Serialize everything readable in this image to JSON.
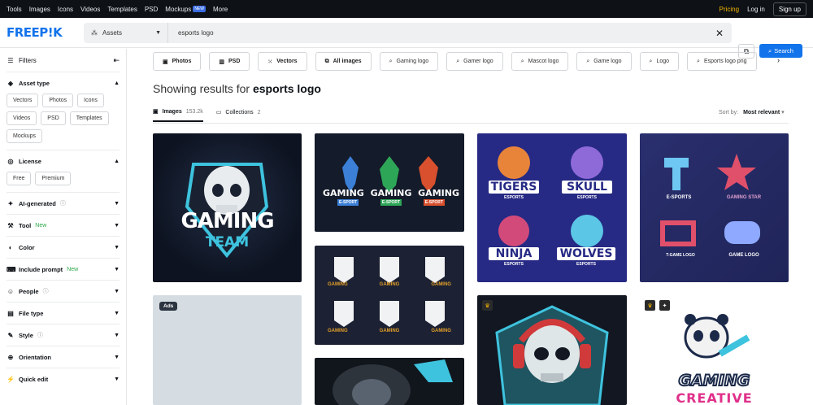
{
  "topnav": {
    "items": [
      "Tools",
      "Images",
      "Icons",
      "Videos",
      "Templates",
      "PSD",
      "Mockups",
      "More"
    ],
    "new_badge": "NEW",
    "pricing": "Pricing",
    "login": "Log in",
    "signup": "Sign up"
  },
  "header": {
    "logo": "FREEP!K",
    "asset_select": "Assets",
    "search_value": "esports logo",
    "search_button": "Search"
  },
  "sidebar": {
    "title": "Filters",
    "asset_type": {
      "label": "Asset type",
      "chips": [
        "Vectors",
        "Photos",
        "Icons",
        "Videos",
        "PSD",
        "Templates",
        "Mockups"
      ]
    },
    "license": {
      "label": "License",
      "chips": [
        "Free",
        "Premium"
      ]
    },
    "sections": [
      {
        "label": "AI-generated",
        "extra": "info"
      },
      {
        "label": "Tool",
        "extra": "New"
      },
      {
        "label": "Color",
        "extra": ""
      },
      {
        "label": "Include prompt",
        "extra": "New"
      },
      {
        "label": "People",
        "extra": "info"
      },
      {
        "label": "File type",
        "extra": ""
      },
      {
        "label": "Style",
        "extra": "info"
      },
      {
        "label": "Orientation",
        "extra": ""
      },
      {
        "label": "Quick edit",
        "extra": ""
      }
    ]
  },
  "filter_tags": [
    "Photos",
    "PSD",
    "Vectors",
    "All images"
  ],
  "suggest_tags": [
    "Gaming logo",
    "Gamer logo",
    "Mascot logo",
    "Game logo",
    "Logo",
    "Esports logo png"
  ],
  "results": {
    "prefix": "Showing results for",
    "query": "esports logo",
    "tabs": [
      {
        "label": "Images",
        "count": "153.2k"
      },
      {
        "label": "Collections",
        "count": "2"
      }
    ],
    "sort_label": "Sort by:",
    "sort_value": "Most relevant"
  },
  "cards": {
    "c1_text1": "GAMING",
    "c1_text2": "TEAM",
    "c2_labels": [
      "GAMING",
      "GAMING",
      "GAMING"
    ],
    "c2_sub": "E-SPORT",
    "c3_labels": [
      "TIGERS",
      "SKULL",
      "NINJA",
      "WOLVES"
    ],
    "c3_sub": "ESPORTS",
    "c4_labels": [
      "E-SPORTS",
      "GAMING STAR",
      "T-GAME LOGO",
      "GAME LOGO"
    ],
    "c5_labels": [
      "GAMING",
      "GAMING",
      "GAMING",
      "GAMING",
      "GAMING",
      "GAMING"
    ],
    "ads": "Ads",
    "c8_text1": "GAMING",
    "c8_text2": "CREATIVE"
  },
  "colors": {
    "accent": "#1273eb",
    "pricing": "#f5b400",
    "new": "#2ba84a"
  }
}
